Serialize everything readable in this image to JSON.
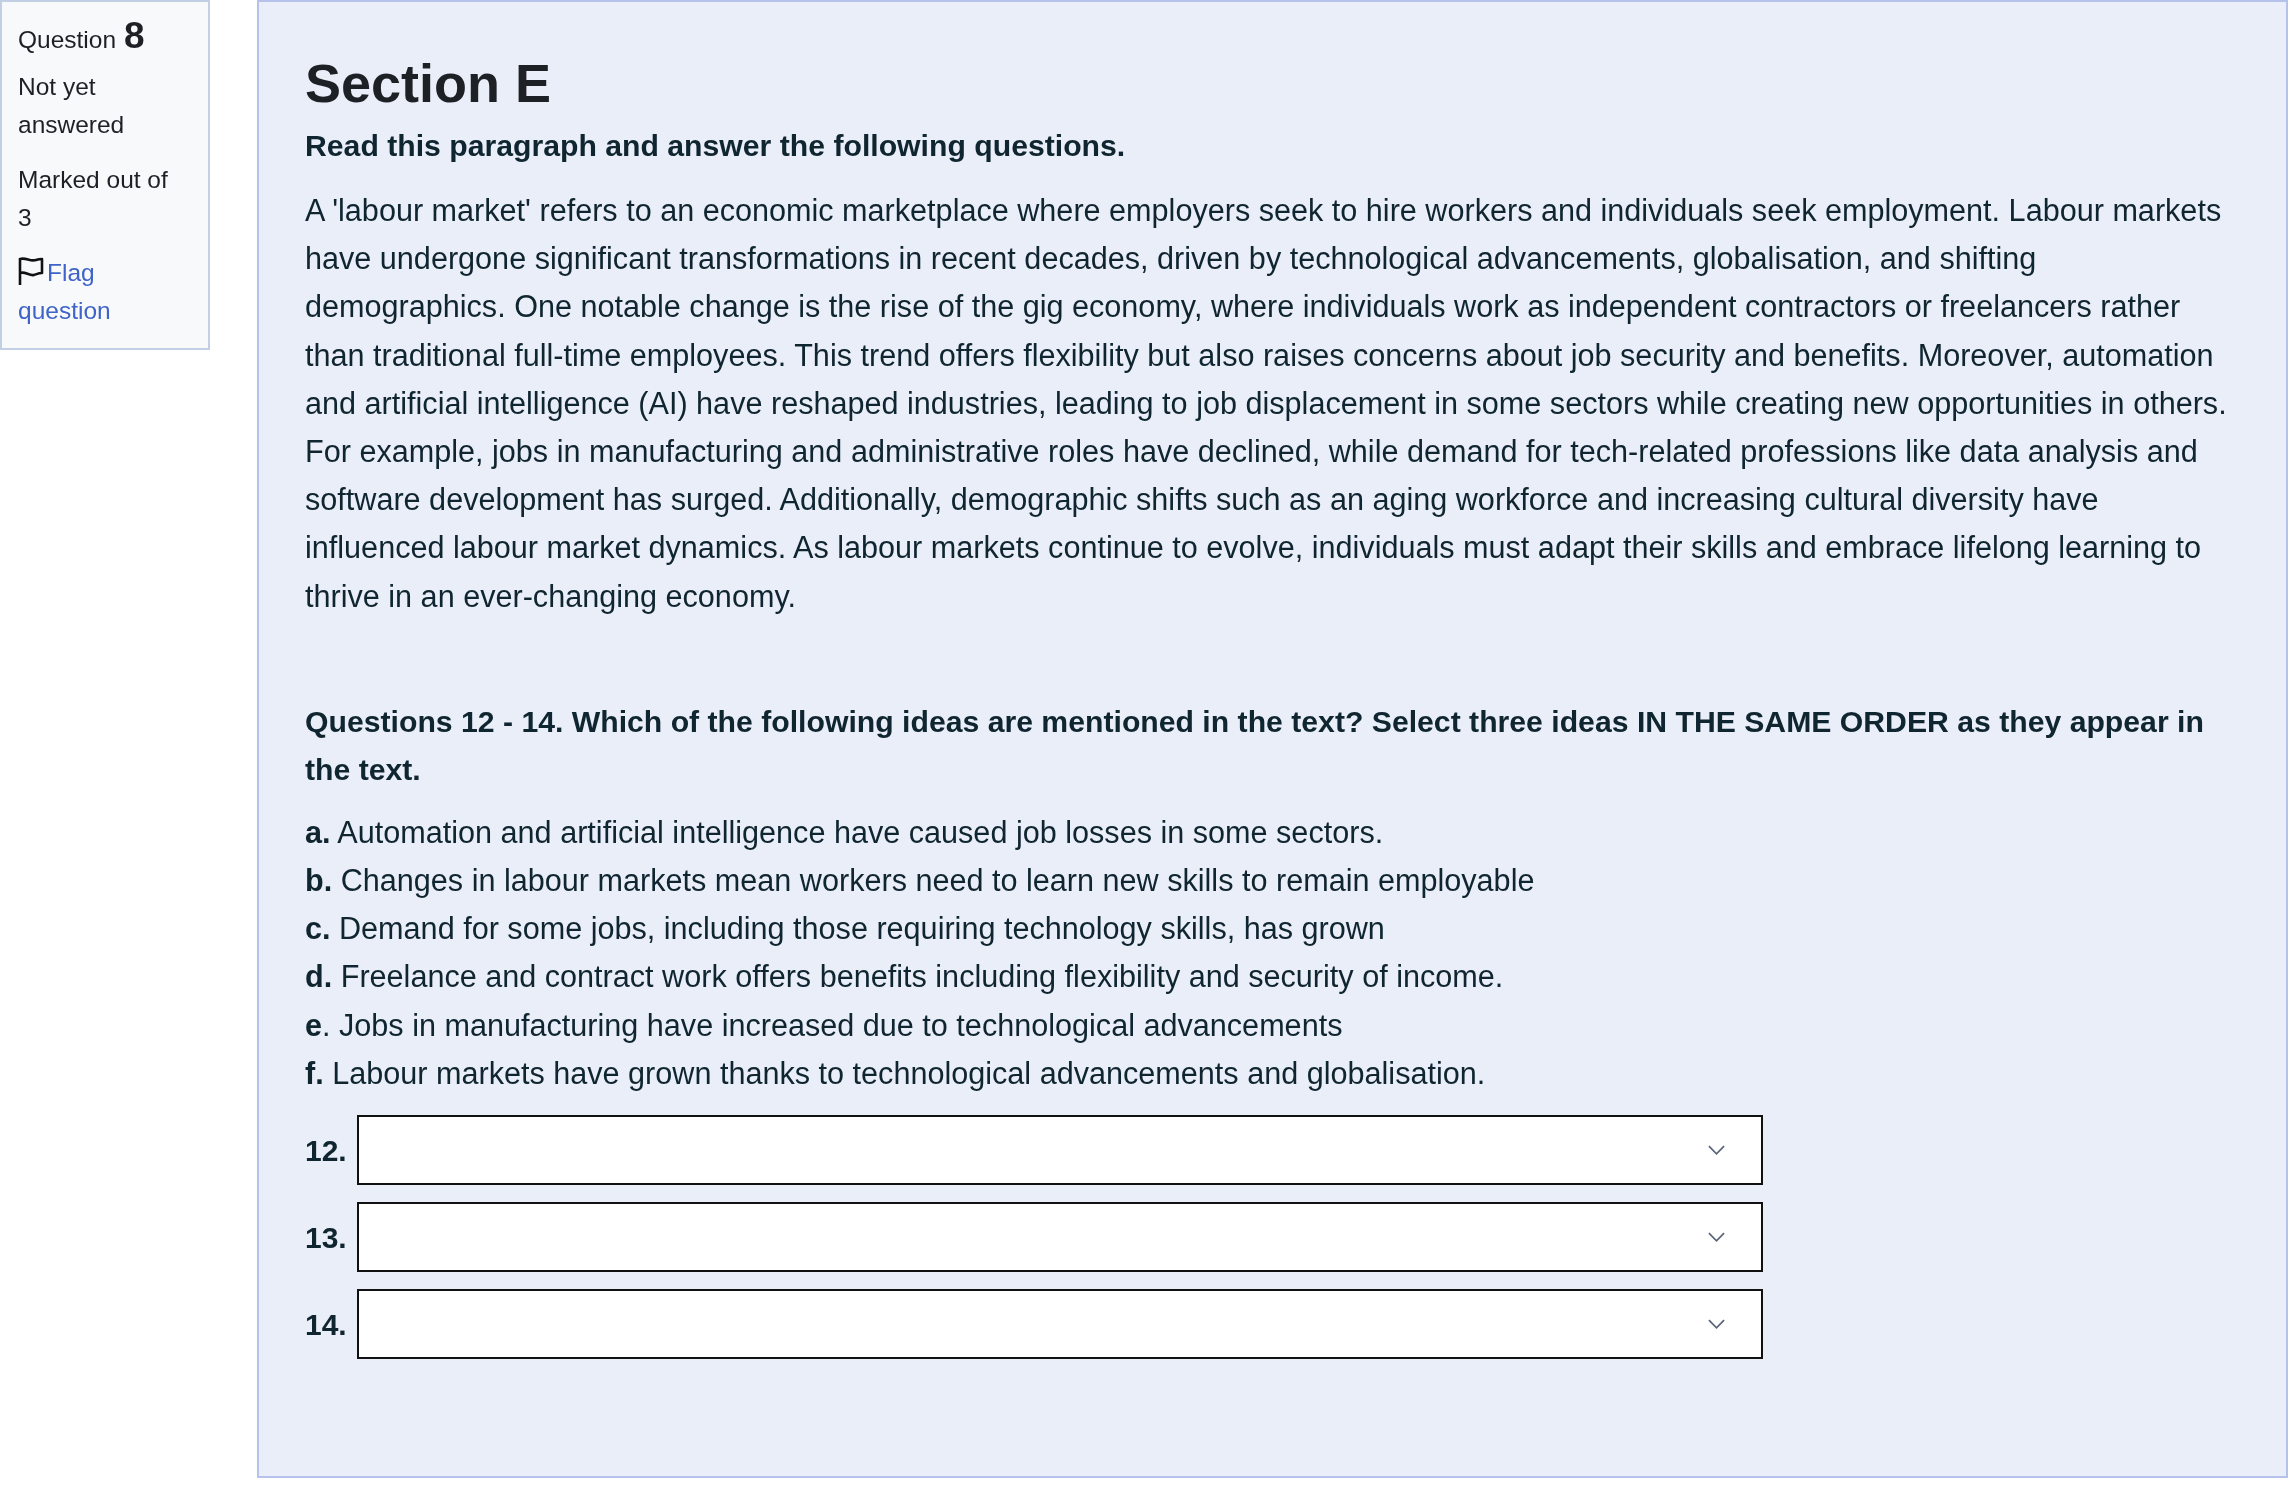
{
  "question_info": {
    "label": "Question",
    "number": "8",
    "state": "Not yet answered",
    "grade": "Marked out of 3",
    "flag_link": "Flag question"
  },
  "content": {
    "title": "Section E",
    "instruction": "Read this paragraph and answer the following questions.",
    "paragraph": "A 'labour market' refers to an economic marketplace where employers seek to hire workers and individuals seek employment. Labour markets have undergone significant transformations in recent decades, driven by technological advancements, globalisation, and shifting demographics. One notable change is the rise of the gig economy, where individuals work as independent contractors or freelancers rather than traditional full-time employees. This trend offers flexibility but also raises concerns about job security and benefits. Moreover, automation and artificial intelligence (AI) have reshaped industries, leading to job displacement in some sectors while creating new opportunities in others. For example, jobs in manufacturing and administrative roles have declined, while demand for tech-related professions like data analysis and software development has surged. Additionally, demographic shifts such as an aging workforce and increasing cultural diversity have influenced labour market dynamics. As labour markets continue to evolve, individuals must adapt their skills and embrace lifelong learning to thrive in an ever-changing economy.",
    "prompt": "Questions 12 - 14. Which of the following ideas are mentioned in the text? Select three ideas IN THE SAME ORDER as they appear in the text.",
    "options": [
      "**a.** Automation and artificial intelligence have caused job losses in some sectors.",
      "**b.** Changes in labour markets mean workers need to learn new skills to remain employable",
      "**c.** Demand for some jobs, including those requiring technology skills, has grown",
      "**d.** Freelance and contract work offers benefits including flexibility and security of income.",
      "**e**. Jobs in manufacturing have increased due to technological advancements",
      "**f.** Labour markets have grown thanks to technological advancements and globalisation."
    ],
    "answers": [
      {
        "label": "12."
      },
      {
        "label": "13."
      },
      {
        "label": "14."
      }
    ]
  }
}
